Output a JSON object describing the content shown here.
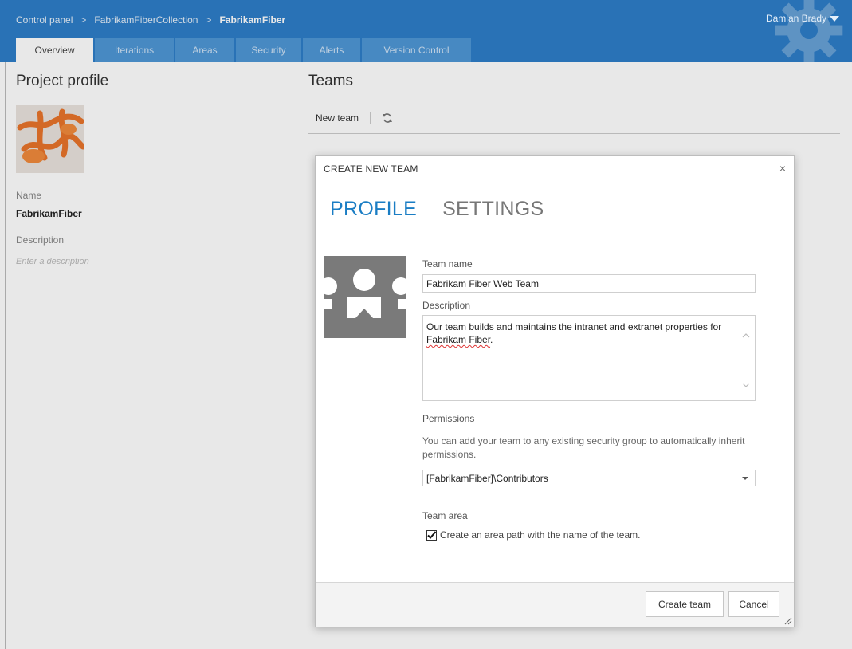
{
  "header": {
    "breadcrumb": [
      "Control panel",
      "FabrikamFiberCollection",
      "FabrikamFiber"
    ],
    "separator": ">",
    "user": "Damian Brady"
  },
  "tabs": [
    {
      "label": "Overview"
    },
    {
      "label": "Iterations"
    },
    {
      "label": "Areas"
    },
    {
      "label": "Security"
    },
    {
      "label": "Alerts"
    },
    {
      "label": "Version Control"
    }
  ],
  "profile": {
    "title": "Project profile",
    "name_label": "Name",
    "name_value": "FabrikamFiber",
    "description_label": "Description",
    "description_placeholder": "Enter a description"
  },
  "teams": {
    "title": "Teams",
    "new_team_label": "New team",
    "refresh_icon": "refresh-icon"
  },
  "dialog": {
    "title": "CREATE NEW TEAM",
    "close_glyph": "×",
    "pivots": [
      "PROFILE",
      "SETTINGS"
    ],
    "team_name_label": "Team name",
    "team_name_value": "Fabrikam Fiber Web Team",
    "description_label": "Description",
    "description_value_part1": "Our team builds and maintains the intranet and extranet properties for ",
    "description_value_part2": "Fabrikam Fiber",
    "description_value_part3": ".",
    "permissions_label": "Permissions",
    "permissions_hint": "You can add your team to any existing security group to automatically inherit permissions.",
    "permissions_value": "[FabrikamFiber]\\Contributors",
    "team_area_label": "Team area",
    "team_area_checkbox_label": "Create an area path with the name of the team.",
    "team_area_checked": true,
    "create_button": "Create team",
    "cancel_button": "Cancel"
  },
  "colors": {
    "header_bg": "#2e7ec8",
    "tab_bg": "#4f97d6",
    "accent": "#1a7dc4",
    "avatar_gray": "#7a7a7a",
    "logo_orange": "#e8742a"
  }
}
